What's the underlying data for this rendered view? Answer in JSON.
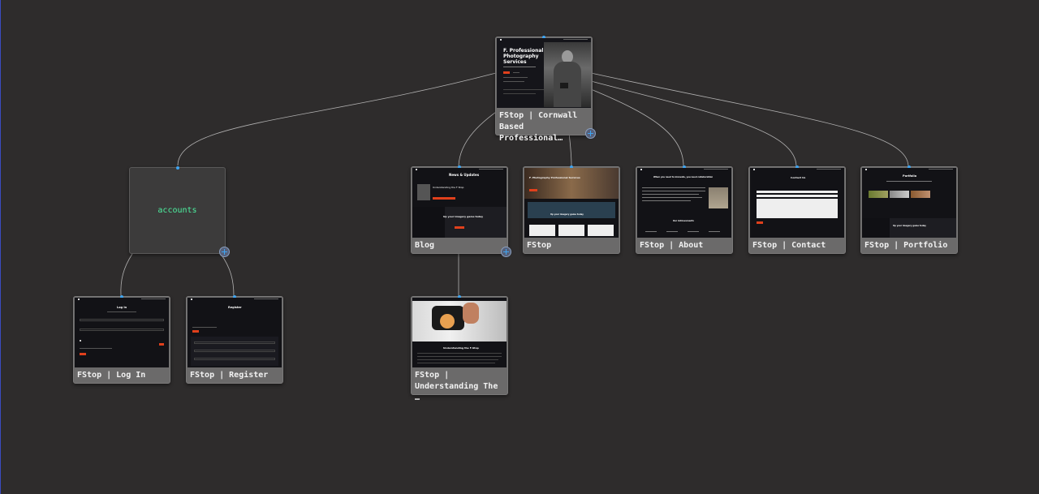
{
  "canvas": {
    "background": "#2e2c2c",
    "link_color": "#c8c8c8",
    "port_color": "#3fa4f0"
  },
  "group": {
    "label": "accounts",
    "label_color": "#4df0a0"
  },
  "nodes": {
    "home": {
      "label": "FStop | Cornwall\nBased Professional…"
    },
    "blog": {
      "label": "Blog"
    },
    "fstop": {
      "label": "FStop"
    },
    "about": {
      "label": "FStop | About"
    },
    "contact": {
      "label": "FStop | Contact"
    },
    "portfolio": {
      "label": "FStop | Portfolio"
    },
    "login": {
      "label": "FStop | Log In"
    },
    "register": {
      "label": "FStop | Register"
    },
    "article": {
      "label": "FStop |\nUnderstanding The …"
    }
  },
  "thumbs": {
    "home_title": "F. Professional\nPhotography\nServices",
    "blog_title": "News & Updates",
    "blog_post": "Understanding the F Stop",
    "blog_cta": "Up your imagery game today",
    "fstop_title": "F. Photography Professional Services",
    "fstop_cta": "Up your imagery game today",
    "about_title": "When you need to innovate, you need collaboration",
    "about_sub": "Our Achievements",
    "contact_title": "Contact Us",
    "portfolio_title": "Portfolio",
    "portfolio_cta": "Up your imagery game today",
    "login_title": "Log In",
    "register_title": "Register",
    "article_title": "Understanding the F-Stop"
  }
}
